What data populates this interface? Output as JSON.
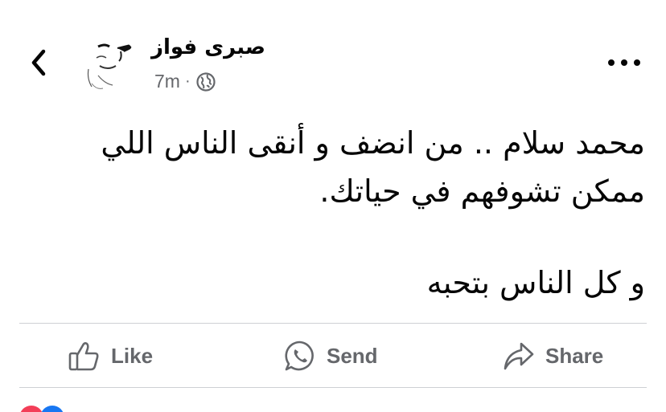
{
  "header": {
    "author_name": "صبرى فواز",
    "timestamp": "7m",
    "separator": "·",
    "audience_icon": "globe-icon",
    "back_icon": "chevron-left-icon",
    "more_icon": "more-dots-icon"
  },
  "post": {
    "lines": [
      "محمد سلام .. من انضف و أنقى الناس اللي",
      "ممكن تشوفهم في حياتك.",
      "و كل الناس بتحبه"
    ]
  },
  "actions": {
    "like_label": "Like",
    "send_label": "Send",
    "share_label": "Share"
  },
  "colors": {
    "secondary_text": "#65676b",
    "divider": "#ced0d4",
    "love_reaction": "#f33e58",
    "like_reaction": "#1877f2"
  }
}
